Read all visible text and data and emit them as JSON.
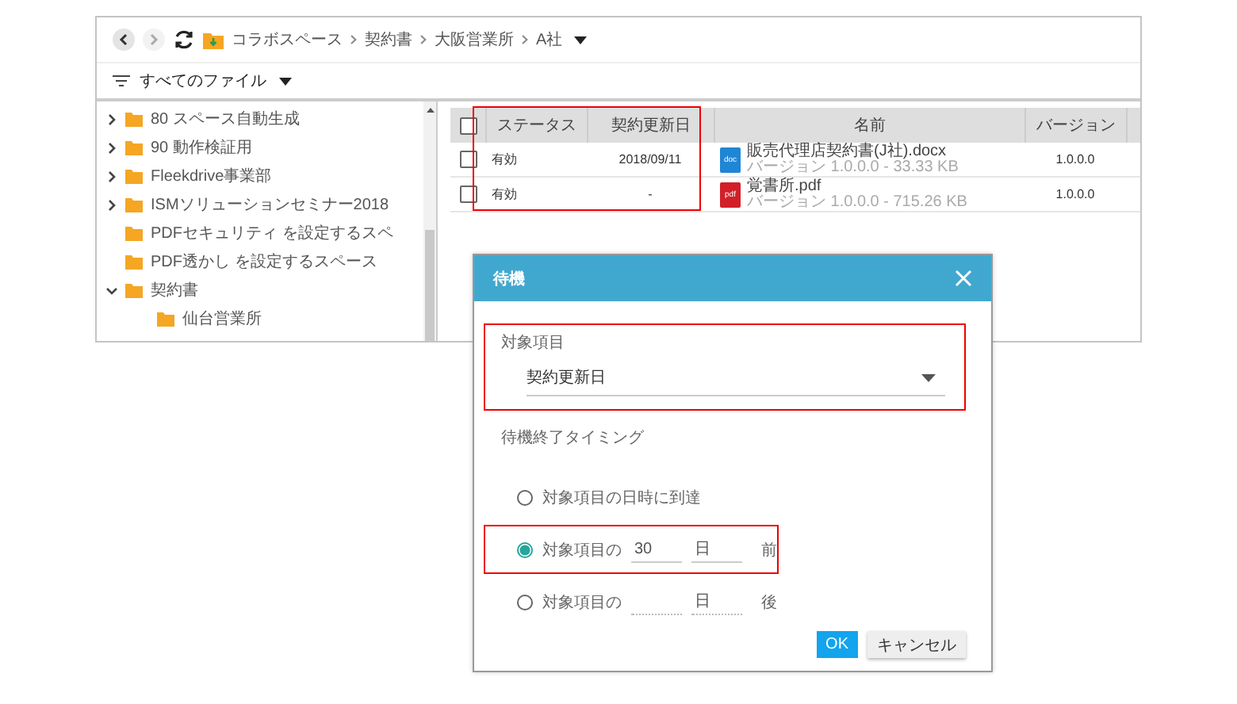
{
  "toolbar": {
    "breadcrumbs": [
      "コラボスペース",
      "契約書",
      "大阪営業所",
      "A社"
    ]
  },
  "filter": {
    "label": "すべてのファイル"
  },
  "tree": [
    {
      "label": "80 スペース自動生成",
      "expanded": false
    },
    {
      "label": "90 動作検証用",
      "expanded": false
    },
    {
      "label": "Fleekdrive事業部",
      "expanded": false
    },
    {
      "label": "ISMソリューションセミナー2018",
      "expanded": false
    },
    {
      "label": "PDFセキュリティ を設定するスペ"
    },
    {
      "label": "PDF透かし を設定するスペース"
    },
    {
      "label": "契約書",
      "expanded": true,
      "children": [
        {
          "label": "仙台営業所"
        }
      ]
    }
  ],
  "table": {
    "header_checked": false,
    "columns": [
      {
        "label": "ステータス",
        "highlighted": true
      },
      {
        "label": "契約更新日",
        "highlighted": true
      },
      {
        "label": "名前",
        "highlighted": false
      },
      {
        "label": "バージョン",
        "highlighted": false
      }
    ],
    "rows": [
      {
        "checked": false,
        "status": "有効",
        "renewal_date": "2018/09/11",
        "file": {
          "type": "doc",
          "name": "販売代理店契約書(J社).docx",
          "meta": "バージョン 1.0.0.0 - 33.33 KB"
        },
        "version": "1.0.0.0"
      },
      {
        "checked": false,
        "status": "有効",
        "renewal_date": "-",
        "file": {
          "type": "pdf",
          "name": "覚書所.pdf",
          "meta": "バージョン 1.0.0.0 - 715.26 KB"
        },
        "version": "1.0.0.0"
      }
    ]
  },
  "dialog": {
    "title": "待機",
    "target_label": "対象項目",
    "target_value": "契約更新日",
    "target_highlighted": true,
    "timing_label": "待機終了タイミング",
    "options": [
      {
        "kind": "reach",
        "label": "対象項目の日時に到達",
        "selected": false,
        "highlighted": false
      },
      {
        "kind": "offset",
        "label": "対象項目の",
        "value": "30",
        "unit": "日",
        "suffix": "前",
        "selected": true,
        "highlighted": true
      },
      {
        "kind": "offset",
        "label": "対象項目の",
        "unit": "日",
        "suffix": "後",
        "selected": false,
        "highlighted": false
      }
    ],
    "buttons": [
      {
        "label": "OK",
        "kind": "primary"
      },
      {
        "label": "キャンセル",
        "kind": "secondary"
      }
    ]
  }
}
